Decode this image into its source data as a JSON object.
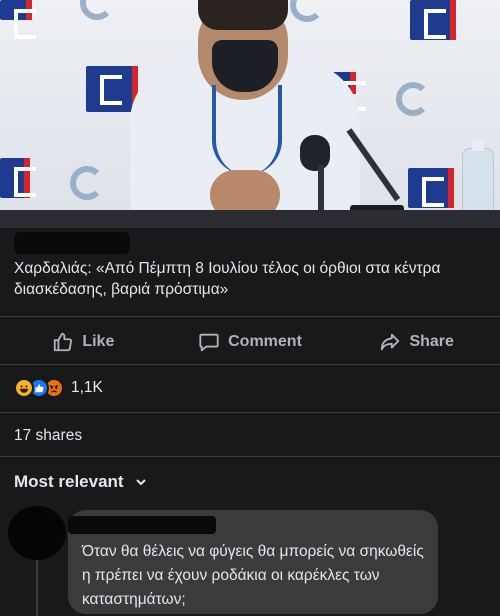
{
  "post": {
    "caption": "Χαρδαλιάς: «Από Πέμπτη 8 Ιουλίου τέλος οι όρθιοι στα κέντρα διασκέδασης, βαριά πρόστιμα»"
  },
  "actions": {
    "like_label": "Like",
    "comment_label": "Comment",
    "share_label": "Share"
  },
  "reactions": {
    "icons": [
      "haha-icon",
      "like-icon",
      "angry-icon"
    ],
    "count": "1,1K"
  },
  "shares": {
    "label": "17 shares"
  },
  "comments": {
    "sort_label": "Most relevant",
    "items": [
      {
        "text": "Όταν θα θέλεις να φύγεις θα μπορείς να σηκωθείς η πρέπει να έχουν ροδάκια οι καρέκλες των καταστημάτων;"
      }
    ]
  },
  "colors": {
    "background": "#18191a",
    "bubble": "#3a3b3c",
    "text": "#e4e6eb",
    "muted": "#b0b3b8",
    "like_blue": "#1877f2",
    "haha_yellow": "#f7b125",
    "angry_orange": "#e9710f"
  }
}
